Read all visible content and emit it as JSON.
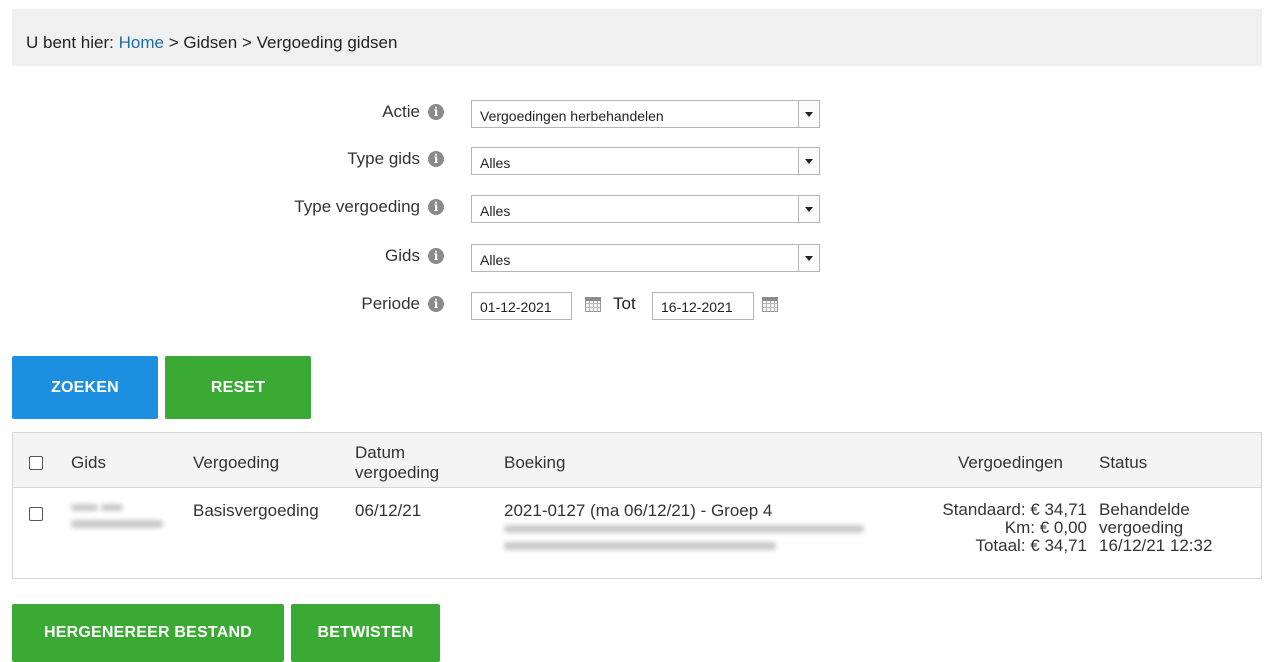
{
  "breadcrumb": {
    "prefix": "U bent hier: ",
    "home": "Home",
    "sep1": " > ",
    "gidsen": "Gidsen",
    "sep2": " > ",
    "current": "Vergoeding gidsen"
  },
  "filters": {
    "actie": {
      "label": "Actie",
      "value": "Vergoedingen herbehandelen"
    },
    "type_gids": {
      "label": "Type gids",
      "value": "Alles"
    },
    "type_vergoeding": {
      "label": "Type vergoeding",
      "value": "Alles"
    },
    "gids": {
      "label": "Gids",
      "value": "Alles"
    },
    "periode": {
      "label": "Periode",
      "from": "01-12-2021",
      "tot_label": "Tot",
      "to": "16-12-2021"
    }
  },
  "buttons": {
    "zoeken": "ZOEKEN",
    "reset": "RESET",
    "hergenereer": "HERGENEREER BESTAND",
    "betwisten": "BETWISTEN"
  },
  "table": {
    "headers": {
      "gids": "Gids",
      "vergoeding": "Vergoeding",
      "datum_line1": "Datum",
      "datum_line2": "vergoeding",
      "boeking": "Boeking",
      "vergoedingen": "Vergoedingen",
      "status": "Status"
    },
    "rows": [
      {
        "vergoeding": "Basisvergoeding",
        "datum": "06/12/21",
        "boeking": "2021-0127 (ma 06/12/21) - Groep 4",
        "standaard": "Standaard: € 34,71",
        "km": "Km: € 0,00",
        "totaal": "Totaal: € 34,71",
        "status_line1": "Behandelde",
        "status_line2": "vergoeding",
        "status_line3": "16/12/21 12:32"
      }
    ]
  },
  "colors": {
    "blue_button": "#1d8fe0",
    "green_button": "#3aaa35",
    "link": "#1f6ea8"
  }
}
